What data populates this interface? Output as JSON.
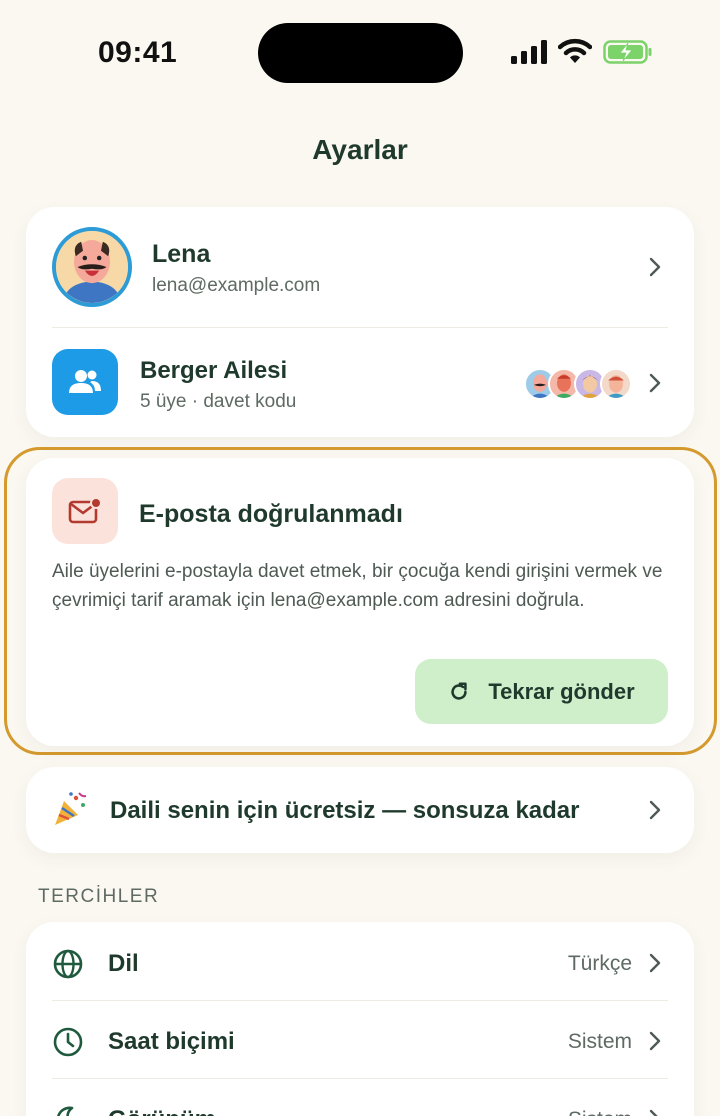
{
  "status_bar": {
    "time": "09:41"
  },
  "page": {
    "title": "Ayarlar"
  },
  "profile": {
    "name": "Lena",
    "email": "lena@example.com"
  },
  "family": {
    "name": "Berger Ailesi",
    "subtitle": "5 üye · davet kodu"
  },
  "verify": {
    "title": "E-posta doğrulanmadı",
    "body": "Aile üyelerini e-postayla davet etmek, bir çocuğa kendi girişini vermek ve çevrimiçi tarif aramak için lena@example.com adresini doğrula.",
    "button_label": "Tekrar gönder"
  },
  "promo": {
    "text": "Daili senin için ücretsiz — sonsuza kadar"
  },
  "preferences": {
    "section_label": "TERCİHLER",
    "items": [
      {
        "label": "Dil",
        "value": "Türkçe",
        "icon": "globe-icon"
      },
      {
        "label": "Saat biçimi",
        "value": "Sistem",
        "icon": "clock-icon"
      },
      {
        "label": "Görünüm",
        "value": "Sistem",
        "icon": "moon-icon"
      }
    ]
  },
  "colors": {
    "background": "#FAF8F1",
    "text_primary": "#1F3A2C",
    "accent_blue": "#1E9BE6",
    "highlight_outline": "#D59A2E",
    "button_green": "#CFEFCB",
    "mail_badge": "#FBE3DC"
  }
}
